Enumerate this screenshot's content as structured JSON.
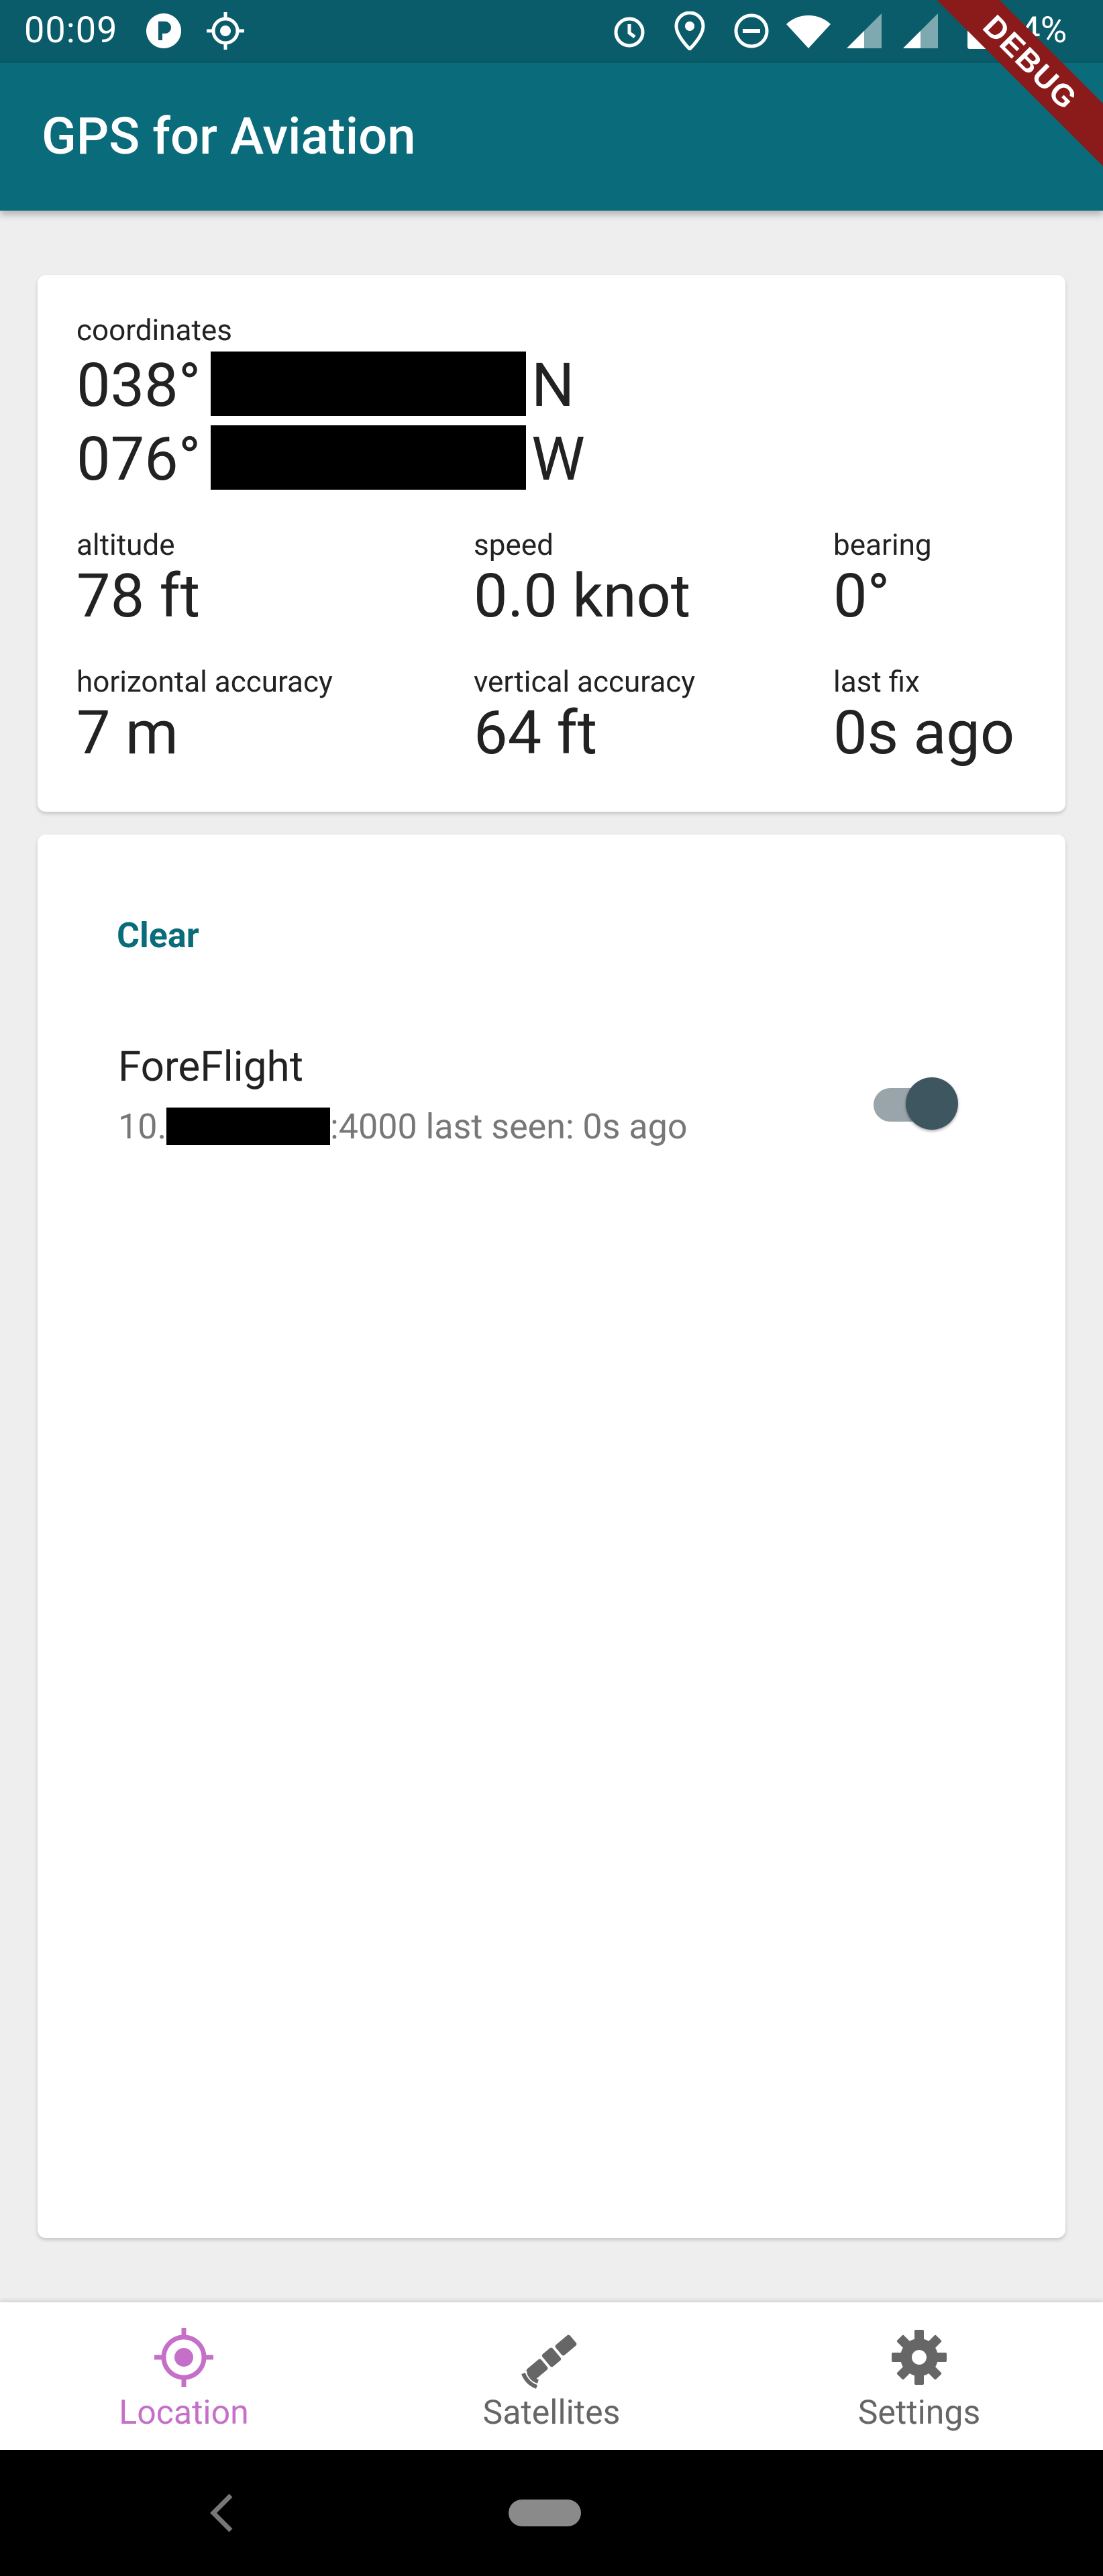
{
  "status_bar": {
    "time": "00:09",
    "battery": "94%",
    "icons": [
      "app-notification-icon",
      "location-target-icon",
      "alarm-icon",
      "location-pin-icon",
      "do-not-disturb-icon",
      "wifi-icon",
      "signal-icon",
      "signal-roaming-icon",
      "battery-icon"
    ]
  },
  "debug_ribbon": "DEBUG",
  "app_bar": {
    "title": "GPS for Aviation"
  },
  "location": {
    "coordinates_label": "coordinates",
    "lat_deg": "038°",
    "lat_dir": "N",
    "lon_deg": "076°",
    "lon_dir": "W",
    "altitude_label": "altitude",
    "altitude": "78 ft",
    "speed_label": "speed",
    "speed": "0.0 knot",
    "bearing_label": "bearing",
    "bearing": "0°",
    "h_acc_label": "horizontal accuracy",
    "h_acc": "7 m",
    "v_acc_label": "vertical accuracy",
    "v_acc": "64 ft",
    "last_fix_label": "last fix",
    "last_fix": "0s ago"
  },
  "connections": {
    "clear_label": "Clear",
    "items": [
      {
        "name": "ForeFlight",
        "address_prefix": "10.",
        "address_suffix": ":4000 last seen: 0s ago",
        "enabled": true
      }
    ]
  },
  "bottom_nav": {
    "items": [
      {
        "label": "Location",
        "icon": "gps-target-icon",
        "active": true
      },
      {
        "label": "Satellites",
        "icon": "satellite-icon",
        "active": false
      },
      {
        "label": "Settings",
        "icon": "gear-icon",
        "active": false
      }
    ],
    "active_color": "#c56fc9",
    "inactive_color": "#666666"
  },
  "colors": {
    "app_bar": "#0a6b7b",
    "status_bar": "#0a5c6a",
    "accent": "#0a6b7b"
  }
}
